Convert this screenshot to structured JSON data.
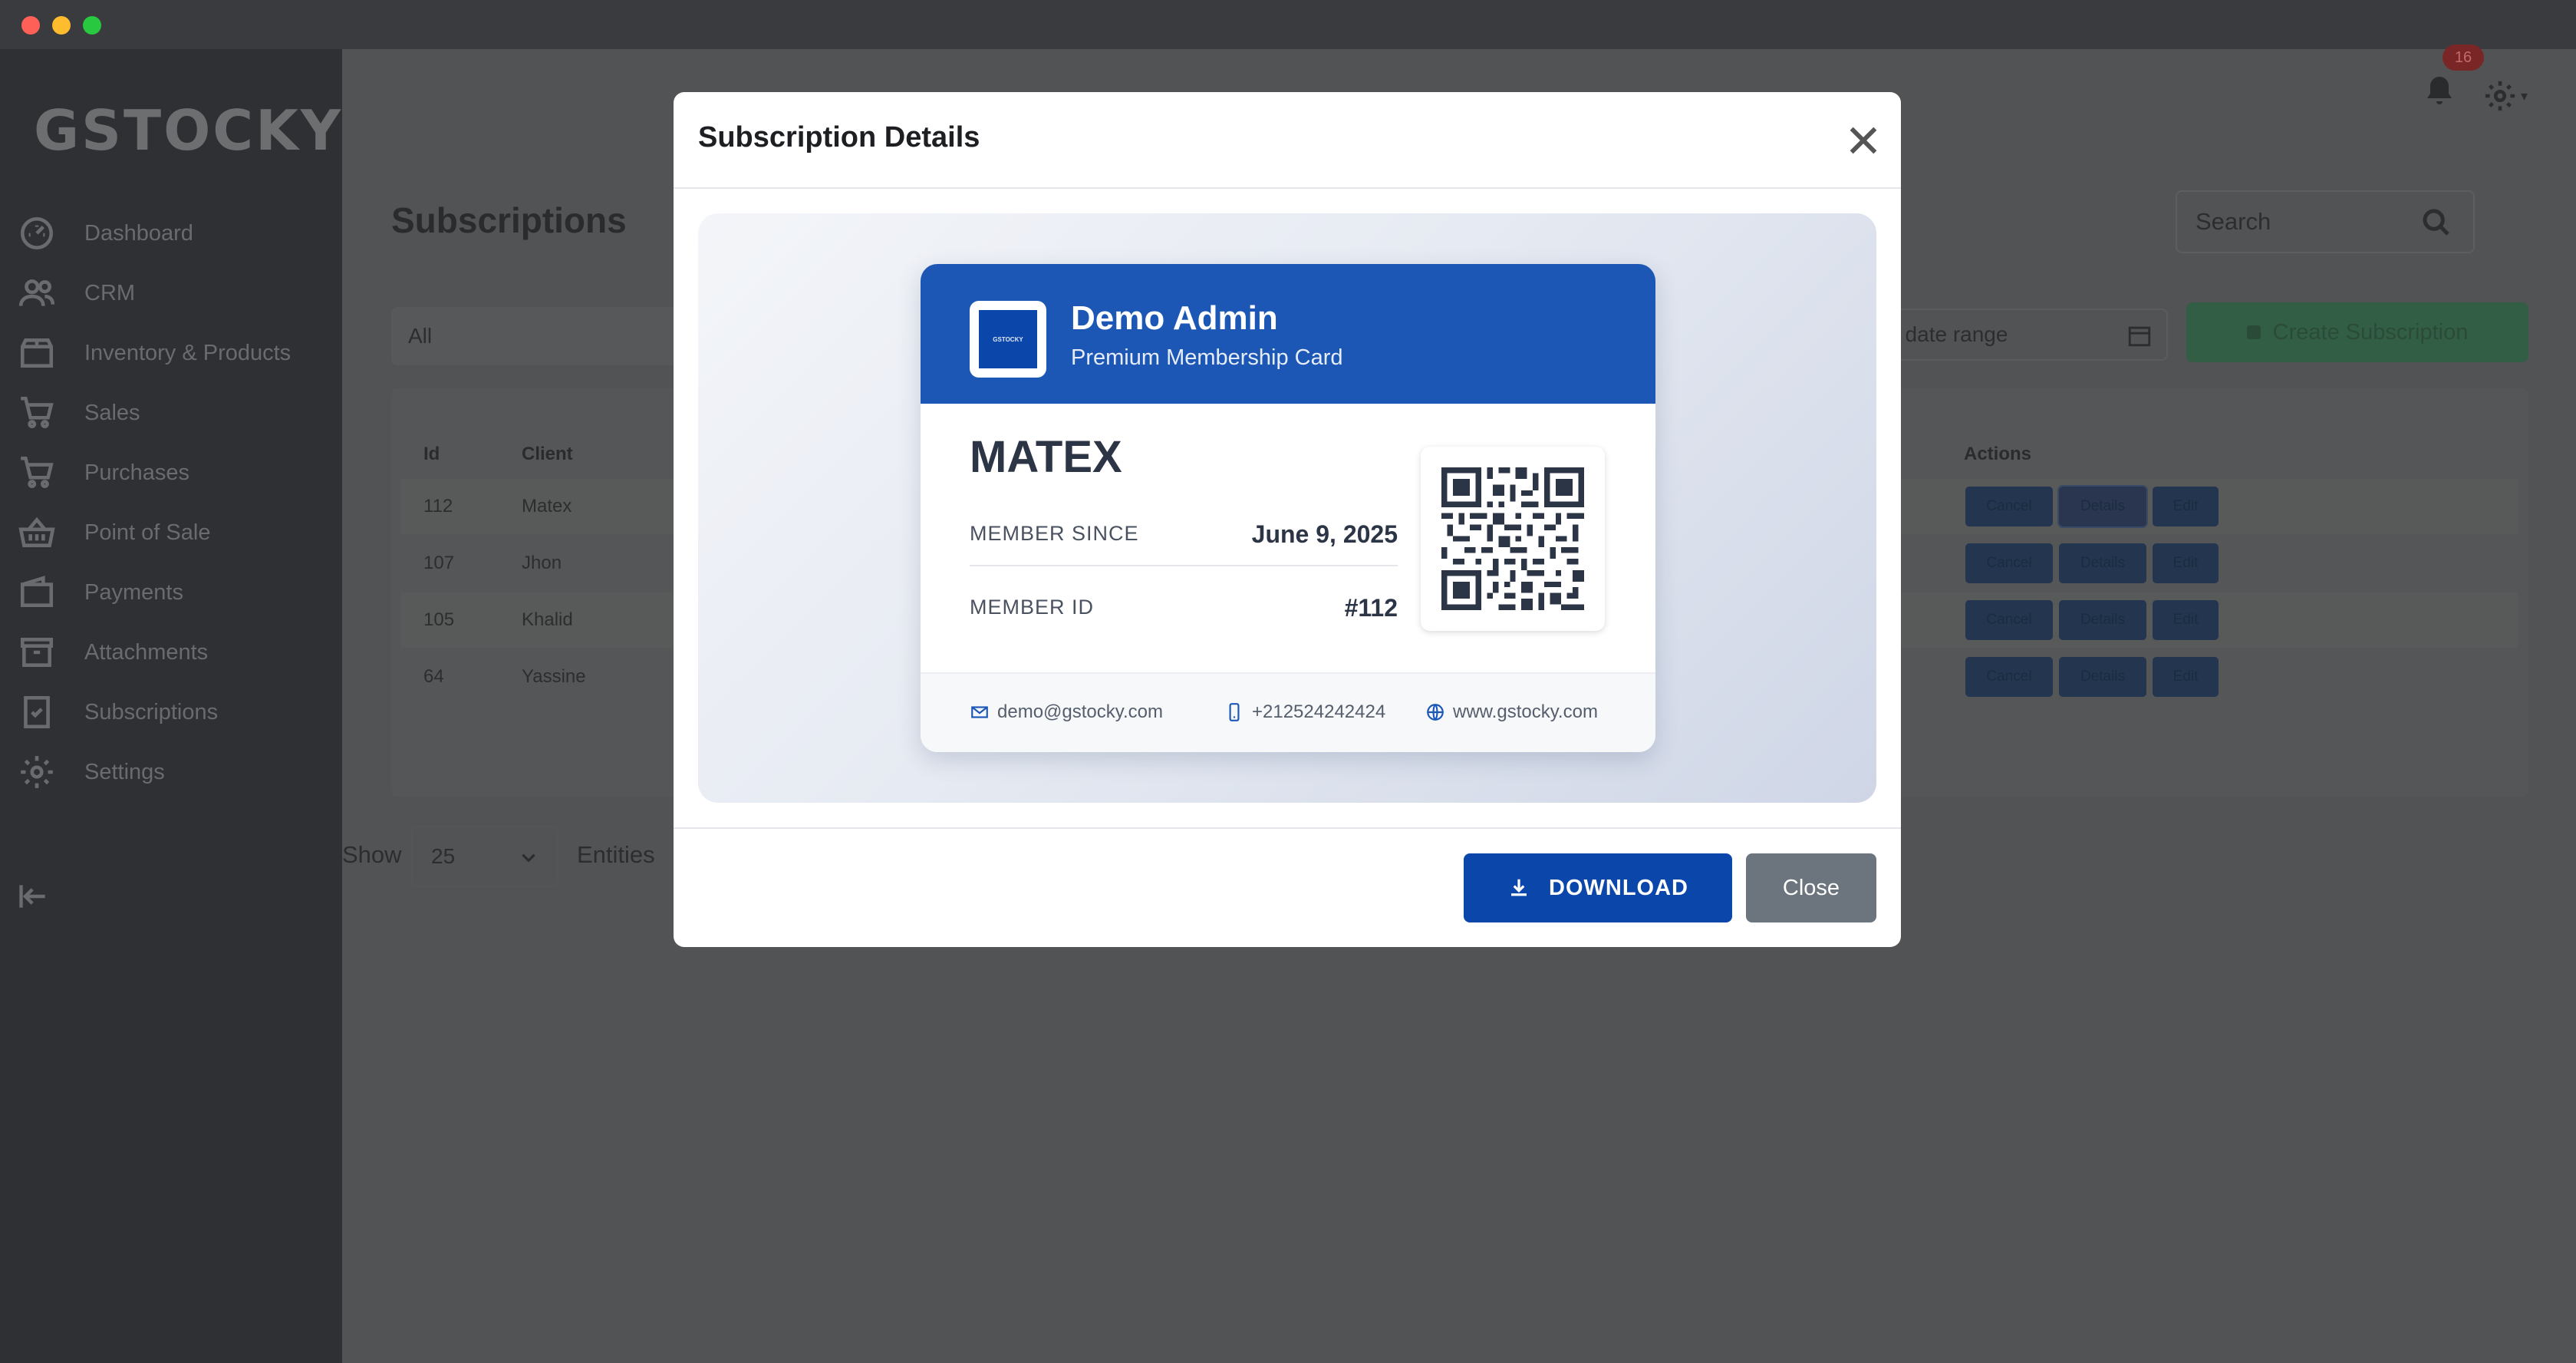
{
  "app": {
    "logo": "GSTOCKY",
    "notifications_count": "16"
  },
  "sidebar": {
    "items": [
      {
        "label": "Dashboard",
        "icon": "dashboard-icon"
      },
      {
        "label": "CRM",
        "icon": "users-icon"
      },
      {
        "label": "Inventory & Products",
        "icon": "box-icon"
      },
      {
        "label": "Sales",
        "icon": "cart-icon"
      },
      {
        "label": "Purchases",
        "icon": "cart-icon"
      },
      {
        "label": "Point of Sale",
        "icon": "basket-icon"
      },
      {
        "label": "Payments",
        "icon": "wallet-icon"
      },
      {
        "label": "Attachments",
        "icon": "archive-icon"
      },
      {
        "label": "Subscriptions",
        "icon": "checklist-icon"
      },
      {
        "label": "Settings",
        "icon": "gear-icon"
      }
    ]
  },
  "page": {
    "title": "Subscriptions",
    "search_placeholder": "Search",
    "filter_value": "All",
    "date_range_placeholder": "t date range",
    "create_button": "Create Subscription",
    "table": {
      "headers": [
        "Id",
        "Client",
        "Actions"
      ],
      "rows": [
        {
          "id": "112",
          "client": "Matex"
        },
        {
          "id": "107",
          "client": "Jhon"
        },
        {
          "id": "105",
          "client": "Khalid"
        },
        {
          "id": "64",
          "client": "Yassine"
        }
      ],
      "actions": {
        "cancel": "Cancel",
        "details": "Details",
        "edit": "Edit"
      }
    },
    "pagination": {
      "show_label": "Show",
      "page_size": "25",
      "entities_label": "Entities"
    }
  },
  "modal": {
    "title": "Subscription Details",
    "download_button": "DOWNLOAD",
    "close_button": "Close",
    "card": {
      "logo_text": "GSTOCKY",
      "name": "Demo Admin",
      "subtitle": "Premium Membership Card",
      "client": "MATEX",
      "member_since_label": "MEMBER SINCE",
      "member_since_value": "June 9, 2025",
      "member_id_label": "MEMBER ID",
      "member_id_value": "#112",
      "email": "demo@gstocky.com",
      "phone": "+212524242424",
      "website": "www.gstocky.com"
    }
  },
  "colors": {
    "primary": "#0b47ab",
    "card_header": "#1c57b5",
    "close_gray": "#6c757d",
    "create_green": "#28a745"
  }
}
